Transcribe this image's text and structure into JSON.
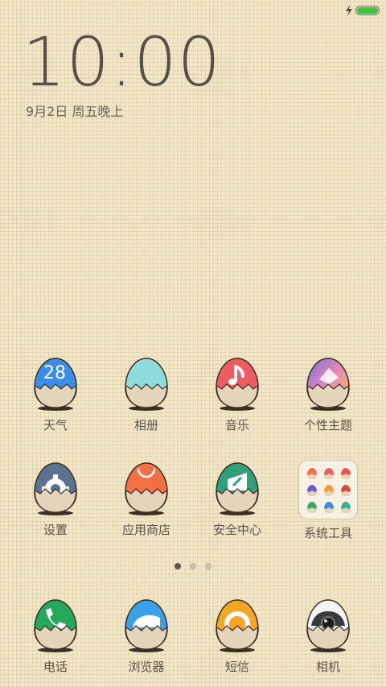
{
  "status_bar": {
    "battery_level": 1.0,
    "charging": true,
    "battery_color": "#3cc23c"
  },
  "lockscreen": {
    "time": "10:00",
    "date": "9月2日 周五晚上"
  },
  "pages": {
    "count": 3,
    "current": 1
  },
  "apps_row1": [
    {
      "label": "天气",
      "icon": "weather-icon",
      "color": "#3b8ee8",
      "badge": "28"
    },
    {
      "label": "相册",
      "icon": "gallery-icon",
      "color": "#8fdcdc"
    },
    {
      "label": "音乐",
      "icon": "music-icon",
      "color": "#ef5b62"
    },
    {
      "label": "个性主题",
      "icon": "themes-icon",
      "color": "#9a7ad6"
    }
  ],
  "apps_row2": [
    {
      "label": "设置",
      "icon": "settings-icon",
      "color": "#5a7490"
    },
    {
      "label": "应用商店",
      "icon": "app-store-icon",
      "color": "#f27044"
    },
    {
      "label": "安全中心",
      "icon": "security-center-icon",
      "color": "#2fa07a"
    },
    {
      "label": "系统工具",
      "icon": "folder-icon",
      "color": "#ffffff"
    }
  ],
  "dock": [
    {
      "label": "电话",
      "icon": "phone-icon",
      "color": "#24a85c"
    },
    {
      "label": "浏览器",
      "icon": "browser-icon",
      "color": "#3aa0e8"
    },
    {
      "label": "短信",
      "icon": "messages-icon",
      "color": "#f5a623"
    },
    {
      "label": "相机",
      "icon": "camera-icon",
      "color": "#f4f4f4"
    }
  ]
}
